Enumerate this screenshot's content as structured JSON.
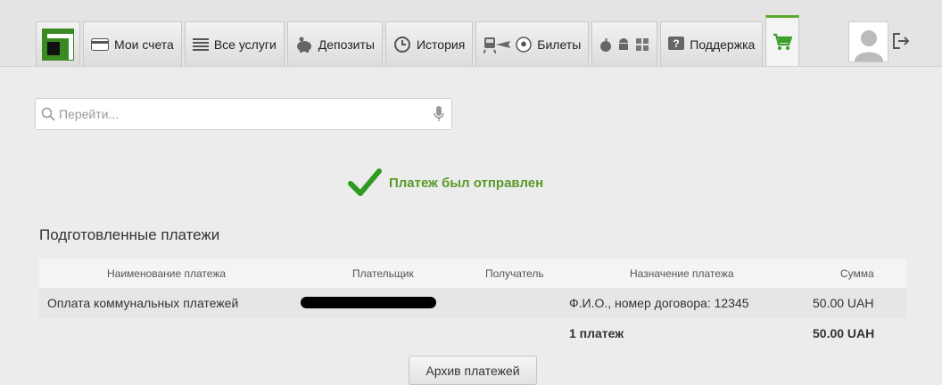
{
  "nav": {
    "accounts": "Мои счета",
    "services": "Все услуги",
    "deposits": "Депозиты",
    "history": "История",
    "tickets": "Билеты",
    "support": "Поддержка"
  },
  "search": {
    "placeholder": "Перейти..."
  },
  "status": {
    "message": "Платеж был отправлен",
    "color": "#5a9a2a"
  },
  "payments": {
    "title": "Подготовленные платежи",
    "columns": [
      "Наименование платежа",
      "Плательщик",
      "Получатель",
      "Назначение платежа",
      "Сумма"
    ],
    "rows": [
      {
        "name": "Оплата коммунальных платежей",
        "payer": "",
        "recipient": "",
        "purpose": "Ф.И.О., номер договора: 12345",
        "amount": "50.00 UAH"
      }
    ],
    "total": {
      "count": "1  платеж",
      "amount": "50.00 UAH"
    },
    "archive_button": "Архив платежей"
  },
  "colors": {
    "brand": "#3a8a23",
    "accent": "#5aaa2a"
  }
}
